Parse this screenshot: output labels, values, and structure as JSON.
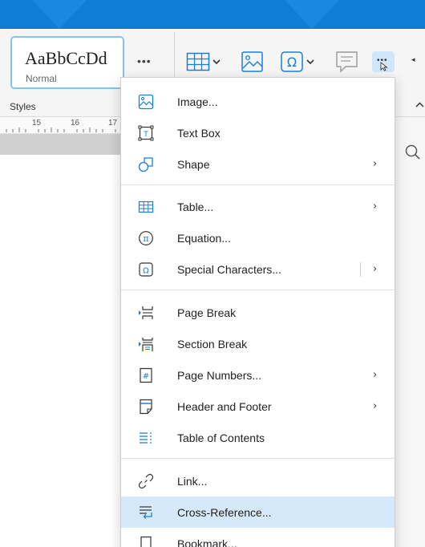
{
  "ribbon": {
    "style_sample": "AaBbCcDd",
    "style_name": "Normal",
    "styles_more": "•••",
    "styles_label": "Styles",
    "more_label": "•••"
  },
  "ruler": {
    "marks": [
      "15",
      "16",
      "17"
    ]
  },
  "menu": {
    "items": [
      {
        "label": "Image...",
        "icon": "image-icon",
        "submenu": false
      },
      {
        "label": "Text Box",
        "icon": "text-box-icon",
        "submenu": false
      },
      {
        "label": "Shape",
        "icon": "shape-icon",
        "submenu": true
      },
      {
        "label": "Table...",
        "icon": "table-icon",
        "submenu": true
      },
      {
        "label": "Equation...",
        "icon": "equation-icon",
        "submenu": false
      },
      {
        "label": "Special Characters...",
        "icon": "omega-icon",
        "submenu": true
      },
      {
        "label": "Page Break",
        "icon": "page-break-icon",
        "submenu": false
      },
      {
        "label": "Section Break",
        "icon": "section-break-icon",
        "submenu": false
      },
      {
        "label": "Page Numbers...",
        "icon": "page-numbers-icon",
        "submenu": true
      },
      {
        "label": "Header and Footer",
        "icon": "header-footer-icon",
        "submenu": true
      },
      {
        "label": "Table of Contents",
        "icon": "table-of-contents-icon",
        "submenu": false
      },
      {
        "label": "Link...",
        "icon": "link-icon",
        "submenu": false
      },
      {
        "label": "Cross-Reference...",
        "icon": "cross-reference-icon",
        "submenu": false,
        "highlighted": true
      },
      {
        "label": "Bookmark...",
        "icon": "bookmark-icon",
        "submenu": false
      }
    ],
    "submenu_arrow": "›"
  },
  "colors": {
    "titlebar": "#0f7cd6",
    "accent": "#1a7fd4",
    "highlight": "#d6e9fb"
  }
}
